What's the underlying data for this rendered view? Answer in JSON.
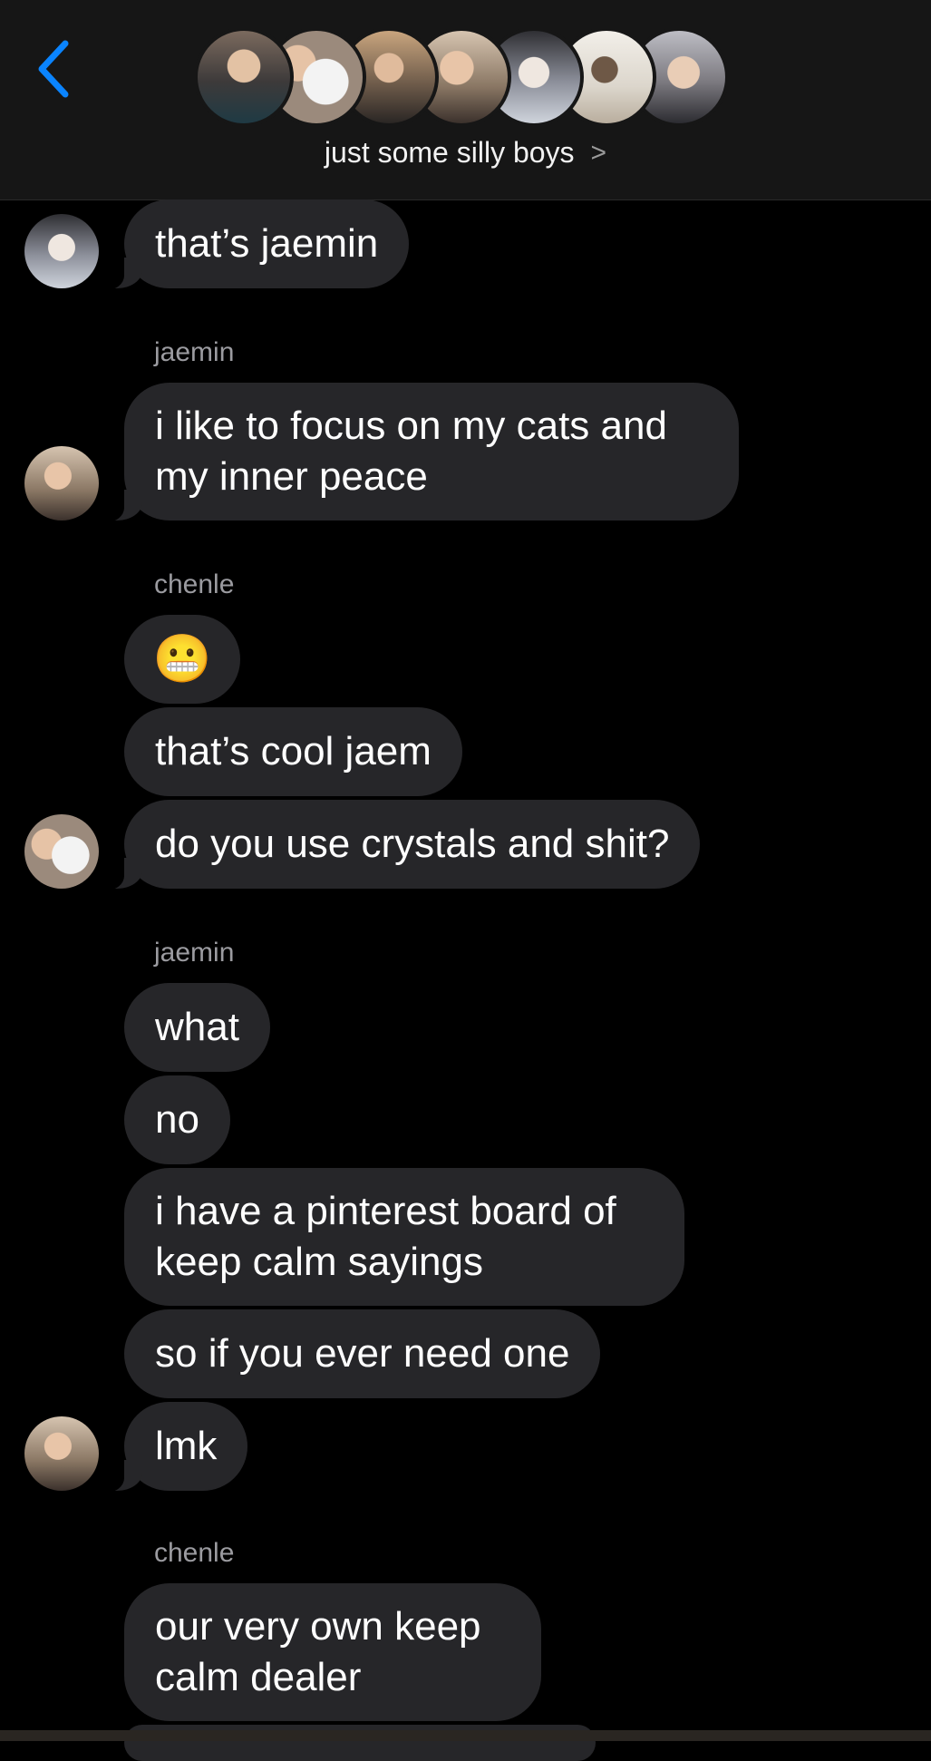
{
  "header": {
    "group_name": "just some silly boys",
    "chevron": ">",
    "back_icon": "chevron-left-icon",
    "accent_color": "#0a84ff"
  },
  "messages": {
    "m1": "that’s jaemin",
    "sender1": "jaemin",
    "m2": "i like to focus on my cats and\nmy inner peace",
    "sender2": "chenle",
    "m3_emoji": "😬",
    "m4": "that’s cool jaem",
    "m5": "do you use crystals and shit?",
    "sender3": "jaemin",
    "m6": "what",
    "m7": "no",
    "m8": "i have a pinterest board of\nkeep calm sayings",
    "m9": "so if you ever need one",
    "m10": "lmk",
    "sender4": "chenle",
    "m11": "our very own keep\ncalm dealer"
  },
  "colors": {
    "bubble": "#262629",
    "background": "#000000",
    "header": "#161616",
    "sender_text": "#9b9ba0"
  }
}
